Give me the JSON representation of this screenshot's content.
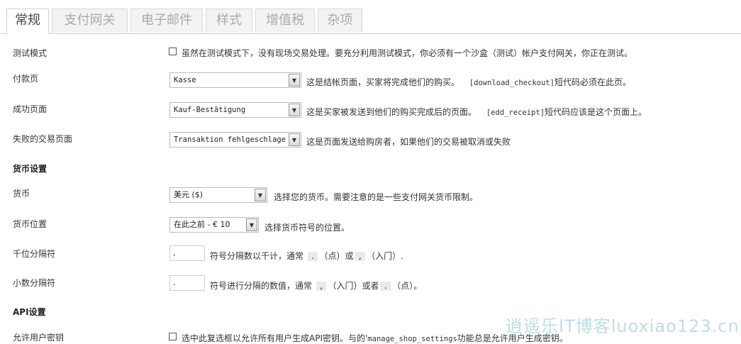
{
  "tabs": [
    "常规",
    "支付网关",
    "电子邮件",
    "样式",
    "增值税",
    "杂项"
  ],
  "test_mode": {
    "label": "测试模式",
    "checkbox_text": "虽然在测试模式下，没有现场交易处理。要充分利用测试模式，你必须有一个沙盒（测试）帐户支付网关，你正在测试。"
  },
  "checkout_page": {
    "label": "付款页",
    "value": "Kasse",
    "desc_text": "这是结帐页面，买家将完成他们的购买。",
    "desc_code": "[download_checkout]",
    "desc_tail": "短代码必须在此页。"
  },
  "success_page": {
    "label": "成功页面",
    "value": "Kauf-Bestätigung",
    "desc_text": "这是买家被发送到他们的购买完成后的页面。",
    "desc_code": "[edd_receipt]",
    "desc_tail": "短代码应该是这个页面上。"
  },
  "failure_page": {
    "label": "失败的交易页面",
    "value": "Transaktion fehlgeschlagen",
    "desc": "这是页面发送给购房者，如果他们的交易被取消或失败"
  },
  "currency_section": "货币设置",
  "currency": {
    "label": "货币",
    "value": "美元 ($)",
    "desc": "选择您的货币。需要注意的是一些支付网关货币限制。"
  },
  "currency_position": {
    "label": "货币位置",
    "value": "在此之前 - € 10",
    "desc": "选择货币符号的位置。"
  },
  "thousands_sep": {
    "label": "千位分隔符",
    "value": ",",
    "desc_a": "符号分隔数以千计，通常",
    "chip1": ".",
    "desc_b": "（点）或",
    "chip2": ",",
    "desc_c": "（入门）."
  },
  "decimal_sep": {
    "label": "小数分隔符",
    "value": ".",
    "desc_a": "符号进行分隔的数值，通常",
    "chip1": ",",
    "desc_b": "（入门）或者",
    "chip2": ".",
    "desc_c": "（点）。"
  },
  "api_section": "API设置",
  "api_keys": {
    "label": "允许用户密钥",
    "checkbox_text_a": "选中此复选框以允许所有用户生成API密钥。与的'",
    "checkbox_code": "manage_shop_settings",
    "checkbox_text_b": "功能总是允许用户生成密钥。"
  },
  "watermark": "逍遥乐IT博客luoxiao123.cn"
}
